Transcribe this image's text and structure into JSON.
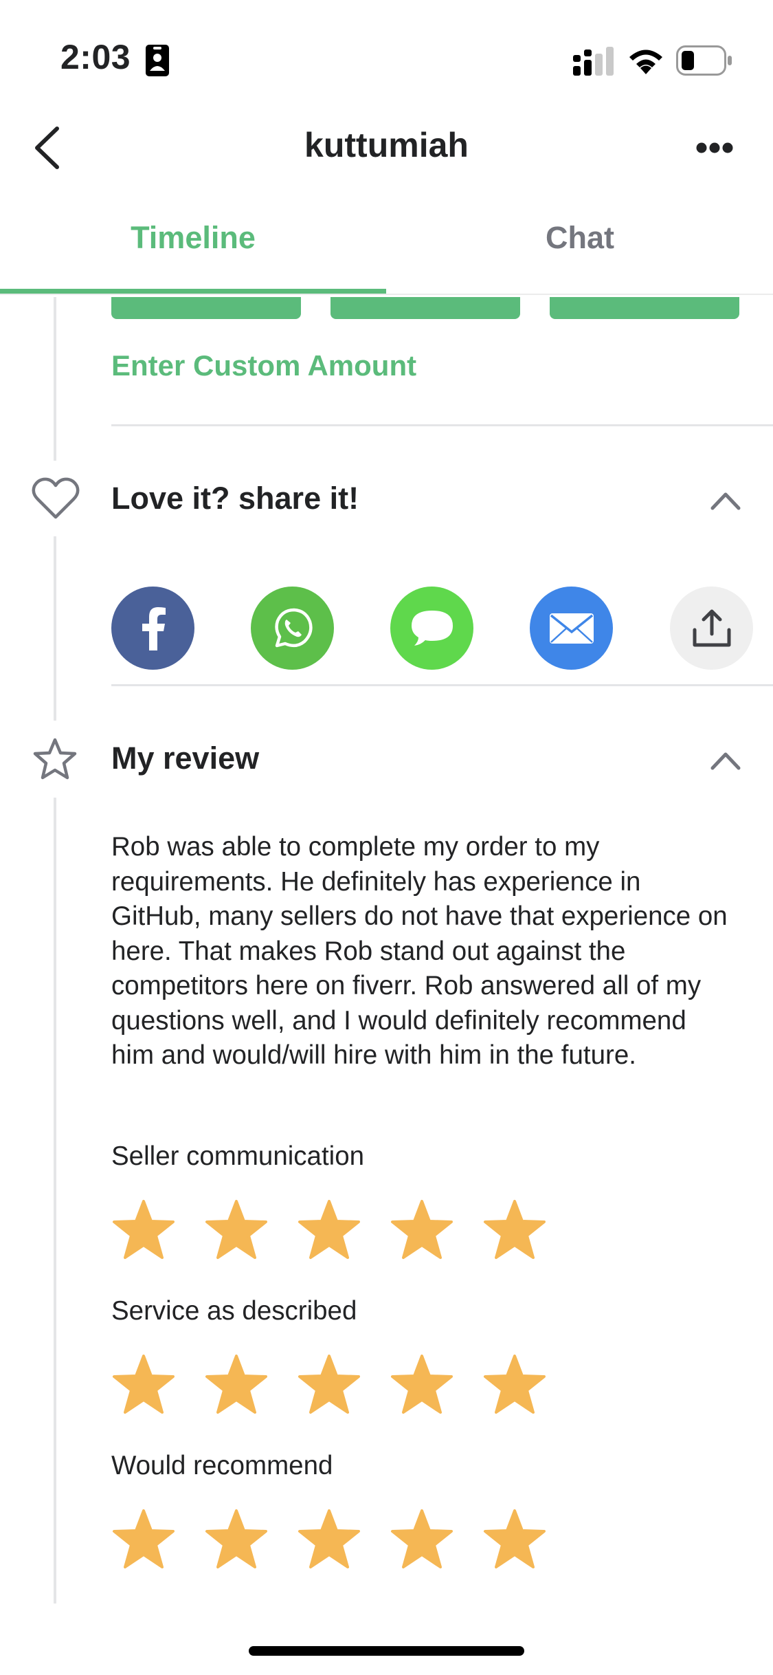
{
  "status_bar": {
    "time": "2:03",
    "icons": [
      "contact-card-icon",
      "signal-icon",
      "wifi-icon",
      "battery-icon"
    ]
  },
  "header": {
    "title": "kuttumiah",
    "back_icon": "chevron-left-icon",
    "more_icon": "more-horizontal-icon"
  },
  "tabs": [
    {
      "label": "Timeline",
      "active": true
    },
    {
      "label": "Chat",
      "active": false
    }
  ],
  "tip": {
    "custom_amount_label": "Enter Custom Amount"
  },
  "share": {
    "title": "Love it? share it!",
    "icons": [
      "facebook-icon",
      "whatsapp-icon",
      "messages-icon",
      "email-icon",
      "share-upload-icon"
    ],
    "colors": {
      "facebook": "#4a6199",
      "whatsapp": "#5dbf4a",
      "messages": "#5fd84c",
      "email": "#3f86e8",
      "share": "#efefef"
    }
  },
  "review": {
    "title": "My review",
    "text": "Rob was able to complete my order to my requirements. He definitely has experience in GitHub, many sellers do not have that experience on here. That makes Rob stand out against the competitors here on fiverr. Rob answered all of my questions well, and I would definitely recommend him and would/will hire with him in the future.",
    "ratings": [
      {
        "label": "Seller communication",
        "stars": 5,
        "max": 5
      },
      {
        "label": "Service as described",
        "stars": 5,
        "max": 5
      },
      {
        "label": "Would recommend",
        "stars": 5,
        "max": 5
      }
    ],
    "star_color": "#f5b754"
  },
  "colors": {
    "accent": "#5bbb7b",
    "muted": "#74767e"
  }
}
